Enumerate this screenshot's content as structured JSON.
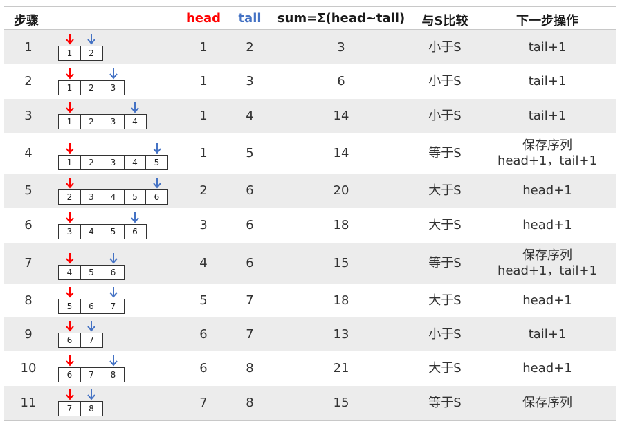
{
  "header": {
    "step": "步骤",
    "head": "head",
    "tail": "tail",
    "sum": "sum=Σ(head~tail)",
    "compare": "与S比较",
    "next_op": "下一步操作"
  },
  "colors": {
    "head_color": "#ff0000",
    "tail_color": "#4472c4",
    "row_stripe": "#ececec",
    "rule": "#c8c8c8"
  },
  "icons": {
    "head_pointer": "red-down-arrow-icon",
    "tail_pointer": "blue-down-arrow-icon"
  },
  "rows": [
    {
      "step": "1",
      "sequence": [
        "1",
        "2"
      ],
      "head": "1",
      "tail": "2",
      "sum": "3",
      "compare": "小于S",
      "op": [
        "tail+1"
      ]
    },
    {
      "step": "2",
      "sequence": [
        "1",
        "2",
        "3"
      ],
      "head": "1",
      "tail": "3",
      "sum": "6",
      "compare": "小于S",
      "op": [
        "tail+1"
      ]
    },
    {
      "step": "3",
      "sequence": [
        "1",
        "2",
        "3",
        "4"
      ],
      "head": "1",
      "tail": "4",
      "sum": "14",
      "compare": "小于S",
      "op": [
        "tail+1"
      ]
    },
    {
      "step": "4",
      "sequence": [
        "1",
        "2",
        "3",
        "4",
        "5"
      ],
      "head": "1",
      "tail": "5",
      "sum": "14",
      "compare": "等于S",
      "op": [
        "保存序列",
        "head+1，tail+1"
      ]
    },
    {
      "step": "5",
      "sequence": [
        "2",
        "3",
        "4",
        "5",
        "6"
      ],
      "head": "2",
      "tail": "6",
      "sum": "20",
      "compare": "大于S",
      "op": [
        "head+1"
      ]
    },
    {
      "step": "6",
      "sequence": [
        "3",
        "4",
        "5",
        "6"
      ],
      "head": "3",
      "tail": "6",
      "sum": "18",
      "compare": "大于S",
      "op": [
        "head+1"
      ]
    },
    {
      "step": "7",
      "sequence": [
        "4",
        "5",
        "6"
      ],
      "head": "4",
      "tail": "6",
      "sum": "15",
      "compare": "等于S",
      "op": [
        "保存序列",
        "head+1，tail+1"
      ]
    },
    {
      "step": "8",
      "sequence": [
        "5",
        "6",
        "7"
      ],
      "head": "5",
      "tail": "7",
      "sum": "18",
      "compare": "大于S",
      "op": [
        "head+1"
      ]
    },
    {
      "step": "9",
      "sequence": [
        "6",
        "7"
      ],
      "head": "6",
      "tail": "7",
      "sum": "13",
      "compare": "小于S",
      "op": [
        "tail+1"
      ]
    },
    {
      "step": "10",
      "sequence": [
        "6",
        "7",
        "8"
      ],
      "head": "6",
      "tail": "8",
      "sum": "21",
      "compare": "大于S",
      "op": [
        "head+1"
      ]
    },
    {
      "step": "11",
      "sequence": [
        "7",
        "8"
      ],
      "head": "7",
      "tail": "8",
      "sum": "15",
      "compare": "等于S",
      "op": [
        "保存序列"
      ]
    }
  ]
}
